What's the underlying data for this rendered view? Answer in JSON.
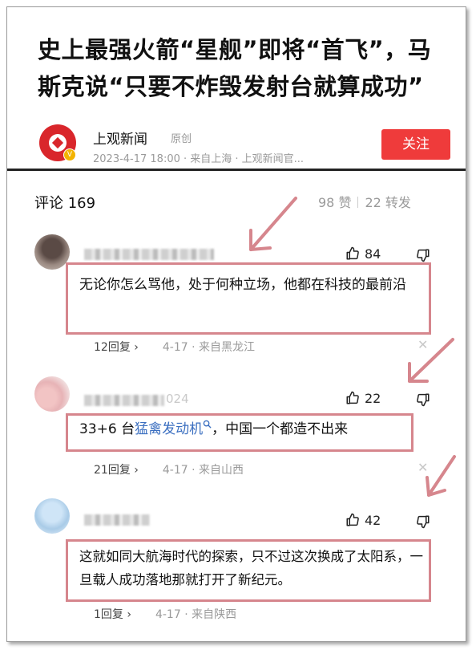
{
  "article": {
    "title": "史上最强火箭“星舰”即将“首飞”，马斯克说“只要不炸毁发射台就算成功”",
    "source": "上观新闻",
    "original_tag": "原创",
    "meta": "2023-4-17 18:00 · 来自上海 · 上观新闻官...",
    "follow_label": "关注"
  },
  "comments_header": {
    "title": "评论 169",
    "likes": "98 赞",
    "shares": "22 转发"
  },
  "comments": [
    {
      "username": "",
      "likes": "84",
      "text": "无论你怎么骂他，处于何种立场，他都在科技的最前沿",
      "replies": "12回复 ›",
      "when": "4-17 · 来自黑龙江"
    },
    {
      "username": "",
      "username_tail": "024",
      "likes": "22",
      "text_prefix": "33+6 台",
      "link_text": "猛禽发动机",
      "text_suffix": "，中国一个都造不出来",
      "replies": "21回复 ›",
      "when": "4-17 · 来自山西"
    },
    {
      "username": "",
      "likes": "42",
      "text": "这就如同大航海时代的探索，只不过这次换成了太阳系，一旦载人成功落地那就打开了新纪元。",
      "replies": "1回复 ›",
      "when": "4-17 · 来自陕西"
    }
  ],
  "colors": {
    "follow_button": "#ef3b3b",
    "annotation": "#d6868d",
    "link": "#3b6fc0"
  },
  "icons": [
    "thumbs-up-icon",
    "thumbs-down-icon",
    "close-icon",
    "search-icon",
    "verified-icon",
    "arrow-annotation"
  ]
}
